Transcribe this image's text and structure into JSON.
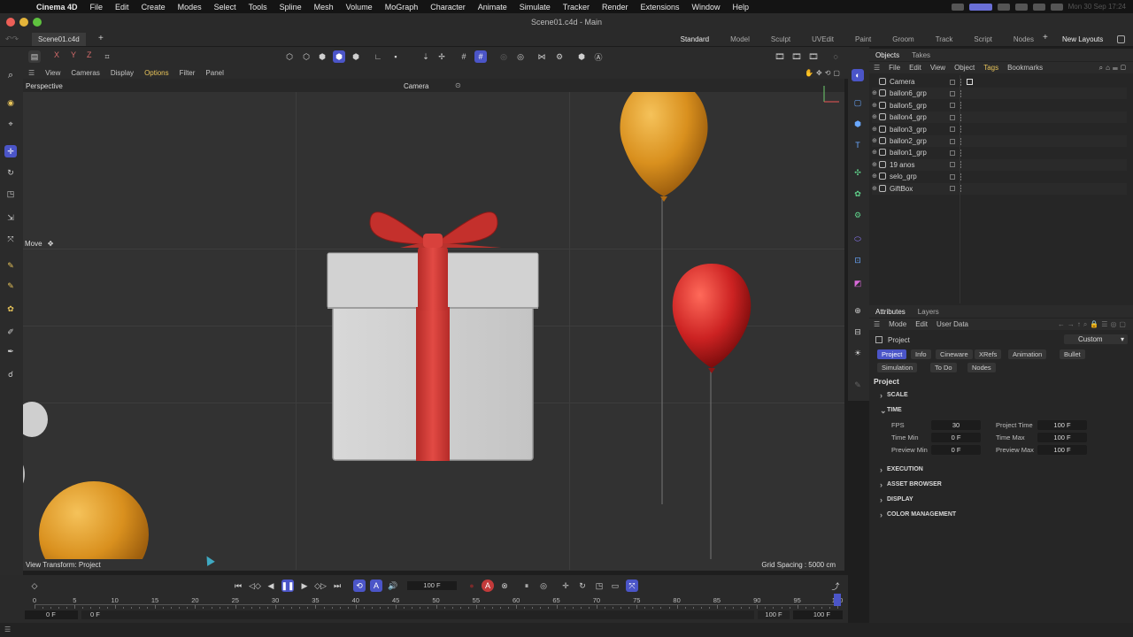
{
  "menubar": {
    "app": "Cinema 4D",
    "items": [
      "File",
      "Edit",
      "Create",
      "Modes",
      "Select",
      "Tools",
      "Spline",
      "Mesh",
      "Volume",
      "MoGraph",
      "Character",
      "Animate",
      "Simulate",
      "Tracker",
      "Render",
      "Extensions",
      "Window",
      "Help"
    ],
    "clock": "Mon 30 Sep 17:24"
  },
  "window": {
    "title": "Scene01.c4d - Main",
    "doc_tab": "Scene01.c4d"
  },
  "layouts": {
    "items": [
      "Standard",
      "Model",
      "Sculpt",
      "UVEdit",
      "Paint",
      "Groom",
      "Track",
      "Script",
      "Nodes"
    ],
    "active": "Standard",
    "new_layouts": "New Layouts"
  },
  "toolbar": {
    "x": "X",
    "y": "Y",
    "z": "Z"
  },
  "viewport": {
    "menu": [
      "View",
      "Cameras",
      "Display",
      "Options",
      "Filter",
      "Panel"
    ],
    "active_menu": "Options",
    "view_name": "Perspective",
    "camera": "Camera",
    "tool": "Move",
    "view_transform": "View Transform: Project",
    "grid_spacing": "Grid Spacing : 5000 cm"
  },
  "objects": {
    "tabs": [
      "Objects",
      "Takes"
    ],
    "menu": [
      "File",
      "Edit",
      "View",
      "Object",
      "Tags",
      "Bookmarks"
    ],
    "active_menu": "Tags",
    "items": [
      "Camera",
      "ballon6_grp",
      "ballon5_grp",
      "ballon4_grp",
      "ballon3_grp",
      "ballon2_grp",
      "ballon1_grp",
      "19 anos",
      "selo_grp",
      "GiftBox"
    ]
  },
  "attributes": {
    "tabs": [
      "Attributes",
      "Layers"
    ],
    "menu": [
      "Mode",
      "Edit",
      "User Data"
    ],
    "object_label": "Project",
    "preset": "Custom",
    "chips_row1": [
      "Project",
      "Info",
      "Cineware",
      "XRefs",
      "Animation",
      "Bullet"
    ],
    "chips_row2": [
      "Simulation",
      "To Do",
      "Nodes"
    ],
    "heading": "Project",
    "sections": [
      "SCALE",
      "TIME",
      "EXECUTION",
      "ASSET BROWSER",
      "DISPLAY",
      "COLOR MANAGEMENT"
    ],
    "fields": {
      "fps_label": "FPS",
      "fps": "30",
      "project_time_label": "Project Time",
      "project_time": "100 F",
      "time_min_label": "Time Min",
      "time_min": "0 F",
      "time_max_label": "Time Max",
      "time_max": "100 F",
      "preview_min_label": "Preview Min",
      "preview_min": "0 F",
      "preview_max_label": "Preview Max",
      "preview_max": "100 F"
    }
  },
  "timeline": {
    "current_frame": "100 F",
    "ticks": [
      "0",
      "5",
      "10",
      "15",
      "20",
      "25",
      "30",
      "35",
      "40",
      "45",
      "50",
      "55",
      "60",
      "65",
      "70",
      "75",
      "80",
      "85",
      "90",
      "95",
      "100"
    ],
    "start_a": "0 F",
    "start_b": "0 F",
    "end_a": "100 F",
    "end_b": "100 F",
    "playhead_fraction": 1.0
  },
  "colors": {
    "accent": "#4b55c8",
    "balloon_orange": "#d9901e",
    "balloon_red": "#cc2222",
    "ribbon": "#cf3a35"
  }
}
